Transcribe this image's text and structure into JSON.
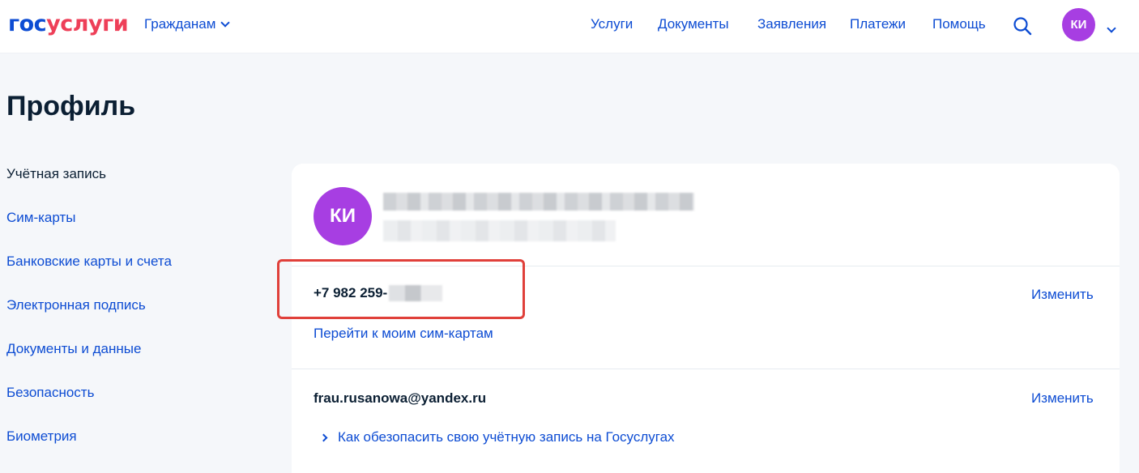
{
  "header": {
    "logo_part1": "гос",
    "logo_part2": "услуги",
    "role": "Гражданам",
    "nav": [
      "Услуги",
      "Документы",
      "Заявления",
      "Платежи",
      "Помощь"
    ],
    "search_icon": "search-icon",
    "avatar_initials": "КИ"
  },
  "page": {
    "title": "Профиль"
  },
  "sidebar": {
    "items": [
      {
        "label": "Учётная запись",
        "active": true
      },
      {
        "label": "Сим-карты"
      },
      {
        "label": "Банковские карты и счета"
      },
      {
        "label": "Электронная подпись"
      },
      {
        "label": "Документы и данные"
      },
      {
        "label": "Безопасность"
      },
      {
        "label": "Биометрия"
      }
    ]
  },
  "profile": {
    "avatar_initials": "КИ",
    "phone": "+7 982 259-",
    "phone_edit": "Изменить",
    "sim_link": "Перейти к моим сим-картам",
    "email": "frau.rusanowa@yandex.ru",
    "email_edit": "Изменить",
    "secure_link": "Как обезопасить свою учётную запись на Госуслугах"
  },
  "colors": {
    "brand_blue": "#0d4cd3",
    "brand_red": "#ee3f58",
    "avatar": "#a73ee2",
    "highlight": "#e0403a"
  }
}
